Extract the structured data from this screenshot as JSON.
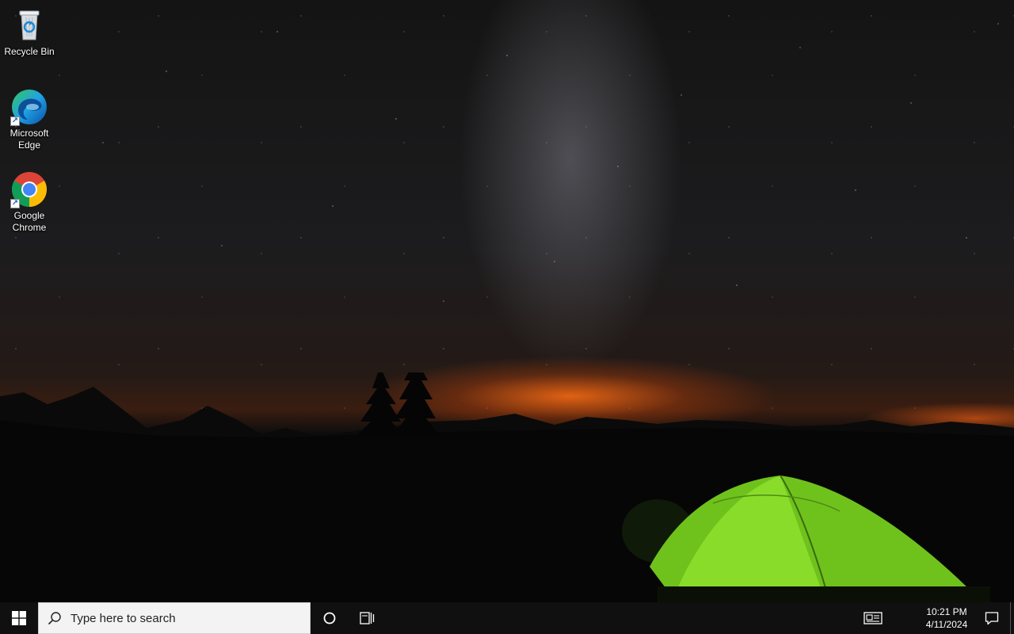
{
  "desktop": {
    "icons": [
      {
        "label": "Recycle Bin",
        "icon": "recycle-bin-icon"
      },
      {
        "label": "Microsoft Edge",
        "icon": "microsoft-edge-icon",
        "shortcut": true
      },
      {
        "label": "Google Chrome",
        "icon": "google-chrome-icon",
        "shortcut": true
      }
    ]
  },
  "taskbar": {
    "start_icon": "windows-logo-icon",
    "search": {
      "placeholder": "Type here to search",
      "value": "",
      "icon": "search-icon"
    },
    "cortana_icon": "cortana-circle-icon",
    "task_view_icon": "task-view-icon",
    "news_icon": "news-and-interests-icon",
    "clock": {
      "time": "10:21 PM",
      "date": "4/11/2024"
    },
    "notifications_icon": "action-center-icon"
  },
  "colors": {
    "taskbar_bg": "#101010",
    "search_bg": "#f3f3f3",
    "windows_blue": "#ffffff",
    "tent_green": "#7ed321",
    "horizon_glow": "#ff6e14"
  }
}
